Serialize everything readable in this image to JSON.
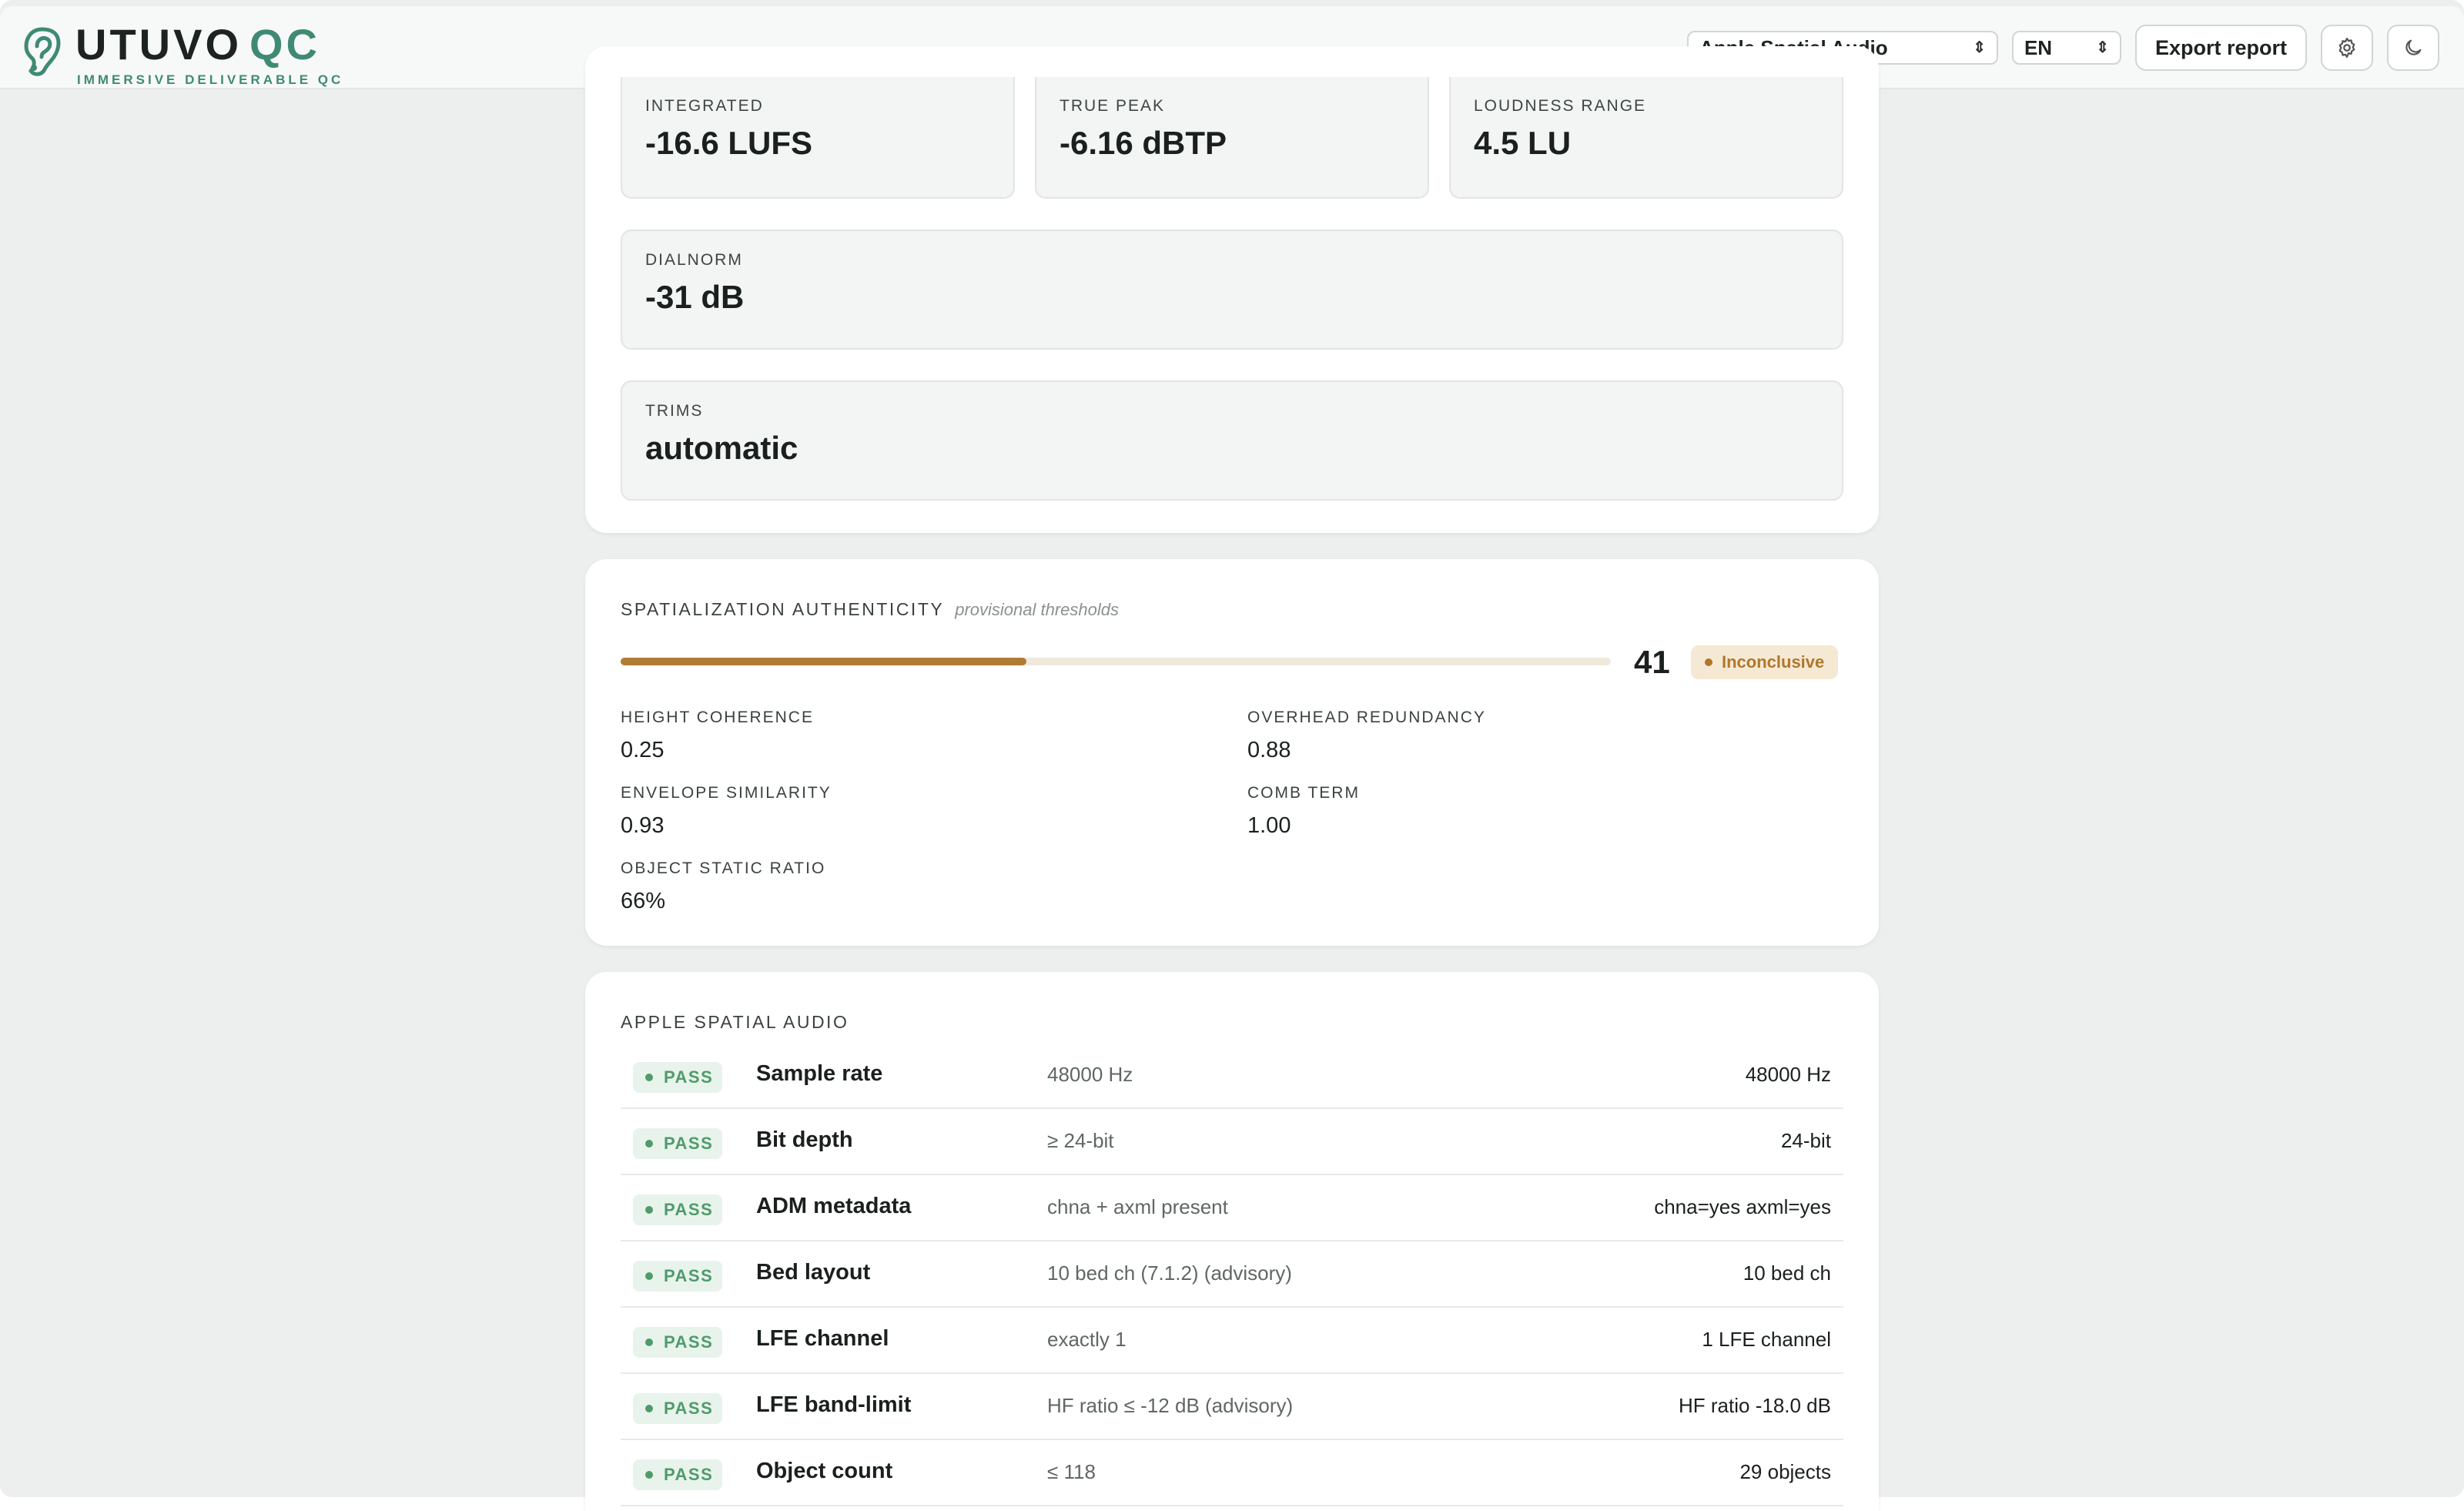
{
  "header": {
    "logo_main": "UTUVO",
    "logo_accent": "QC",
    "logo_tagline": "IMMERSIVE DELIVERABLE QC",
    "profile_select": "Apple Spatial Audio",
    "language_select": "EN",
    "export_label": "Export report",
    "icons": [
      "ear-logo-icon",
      "gear-icon",
      "moon-icon"
    ]
  },
  "loudness": {
    "integrated": {
      "label": "INTEGRATED",
      "value": "-16.6 LUFS"
    },
    "true_peak": {
      "label": "TRUE PEAK",
      "value": "-6.16 dBTP"
    },
    "loudness_range": {
      "label": "LOUDNESS RANGE",
      "value": "4.5 LU"
    },
    "dialnorm": {
      "label": "DIALNORM",
      "value": "-31 dB"
    },
    "trims": {
      "label": "TRIMS",
      "value": "automatic"
    }
  },
  "spatialization": {
    "title": "SPATIALIZATION AUTHENTICITY",
    "note": "provisional thresholds",
    "score": "41",
    "score_fraction": 0.41,
    "status": "Inconclusive",
    "metrics": {
      "height_coherence": {
        "label": "HEIGHT COHERENCE",
        "value": "0.25"
      },
      "overhead_redundancy": {
        "label": "OVERHEAD REDUNDANCY",
        "value": "0.88"
      },
      "envelope_similarity": {
        "label": "ENVELOPE SIMILARITY",
        "value": "0.93"
      },
      "comb_term": {
        "label": "COMB TERM",
        "value": "1.00"
      },
      "object_static_ratio": {
        "label": "OBJECT STATIC RATIO",
        "value": "66%"
      }
    }
  },
  "checks": {
    "title": "APPLE SPATIAL AUDIO",
    "rows": [
      {
        "status": "PASS",
        "name": "Sample rate",
        "rule": "48000 Hz",
        "result": "48000 Hz"
      },
      {
        "status": "PASS",
        "name": "Bit depth",
        "rule": "≥ 24-bit",
        "result": "24-bit"
      },
      {
        "status": "PASS",
        "name": "ADM metadata",
        "rule": "chna + axml present",
        "result": "chna=yes axml=yes"
      },
      {
        "status": "PASS",
        "name": "Bed layout",
        "rule": "10 bed ch (7.1.2) (advisory)",
        "result": "10 bed ch"
      },
      {
        "status": "PASS",
        "name": "LFE channel",
        "rule": "exactly 1",
        "result": "1 LFE channel"
      },
      {
        "status": "PASS",
        "name": "LFE band-limit",
        "rule": "HF ratio ≤ -12 dB (advisory)",
        "result": "HF ratio -18.0 dB"
      },
      {
        "status": "PASS",
        "name": "Object count",
        "rule": "≤ 118",
        "result": "29 objects"
      }
    ]
  },
  "colors": {
    "accent": "#3f8a74",
    "warning": "#b0772b",
    "pass": "#4f9b6a",
    "background": "#ecefee"
  }
}
